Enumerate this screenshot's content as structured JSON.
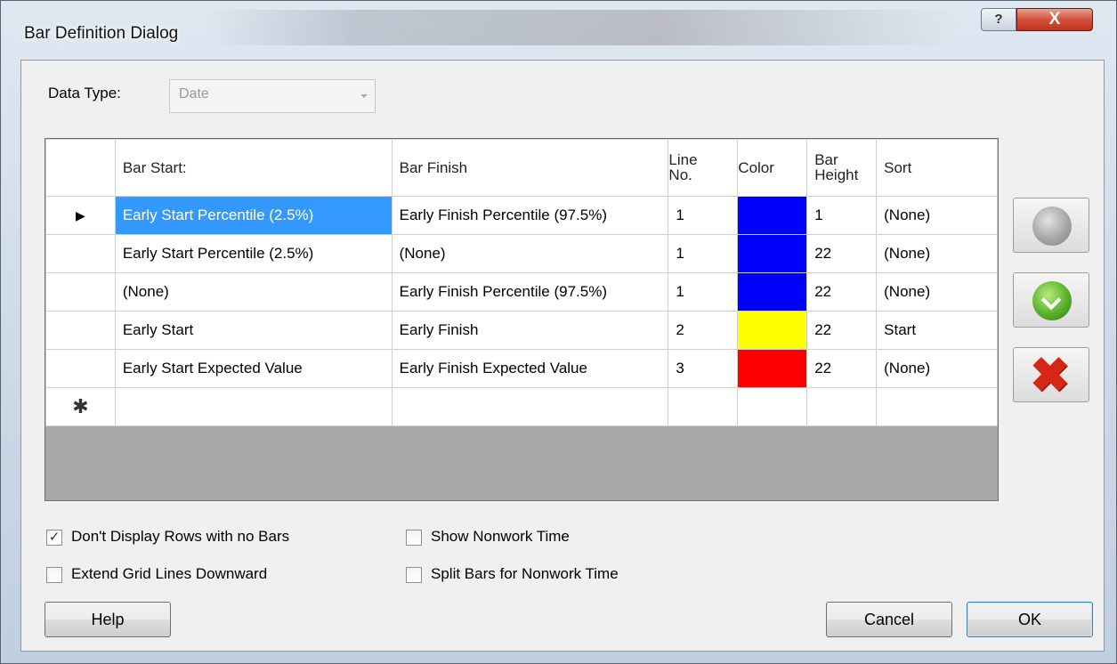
{
  "window": {
    "title": "Bar Definition Dialog",
    "help_button": "?",
    "close_button": "X"
  },
  "data_type": {
    "label": "Data Type:",
    "value": "Date"
  },
  "grid": {
    "columns": [
      {
        "label": "Bar Start:"
      },
      {
        "label": "Bar Finish"
      },
      {
        "label_line1": "Line",
        "label_line2": "No."
      },
      {
        "label": "Color"
      },
      {
        "label_line1": "Bar",
        "label_line2": "Height"
      },
      {
        "label": "Sort"
      }
    ],
    "rows": [
      {
        "bar_start": "Early Start Percentile (2.5%)",
        "bar_finish": "Early Finish Percentile (97.5%)",
        "line_no": "1",
        "color": "#0000ff",
        "bar_height": "1",
        "sort": "(None)",
        "selected": true
      },
      {
        "bar_start": "Early Start Percentile (2.5%)",
        "bar_finish": "(None)",
        "line_no": "1",
        "color": "#0000ff",
        "bar_height": "22",
        "sort": "(None)"
      },
      {
        "bar_start": "(None)",
        "bar_finish": "Early Finish Percentile (97.5%)",
        "line_no": "1",
        "color": "#0000ff",
        "bar_height": "22",
        "sort": "(None)"
      },
      {
        "bar_start": "Early Start",
        "bar_finish": "Early Finish",
        "line_no": "2",
        "color": "#ffff00",
        "bar_height": "22",
        "sort": "Start"
      },
      {
        "bar_start": "Early Start Expected Value",
        "bar_finish": "Early Finish Expected Value",
        "line_no": "3",
        "color": "#ff0000",
        "bar_height": "22",
        "sort": "(None)"
      }
    ],
    "current_row_marker": "▶",
    "new_row_marker": "✱"
  },
  "side_buttons": [
    "grey-circle-icon",
    "green-down-arrow-icon",
    "red-x-delete-icon"
  ],
  "options": {
    "dont_display_rows": {
      "label": "Don't Display Rows with no Bars",
      "checked": true,
      "mark": "✓"
    },
    "extend_grid_lines": {
      "label": "Extend Grid Lines Downward",
      "checked": false
    },
    "show_nonwork": {
      "label": "Show Nonwork Time",
      "checked": false
    },
    "split_bars": {
      "label": "Split Bars for Nonwork Time",
      "checked": false
    }
  },
  "buttons": {
    "help": "Help",
    "cancel": "Cancel",
    "ok": "OK"
  }
}
